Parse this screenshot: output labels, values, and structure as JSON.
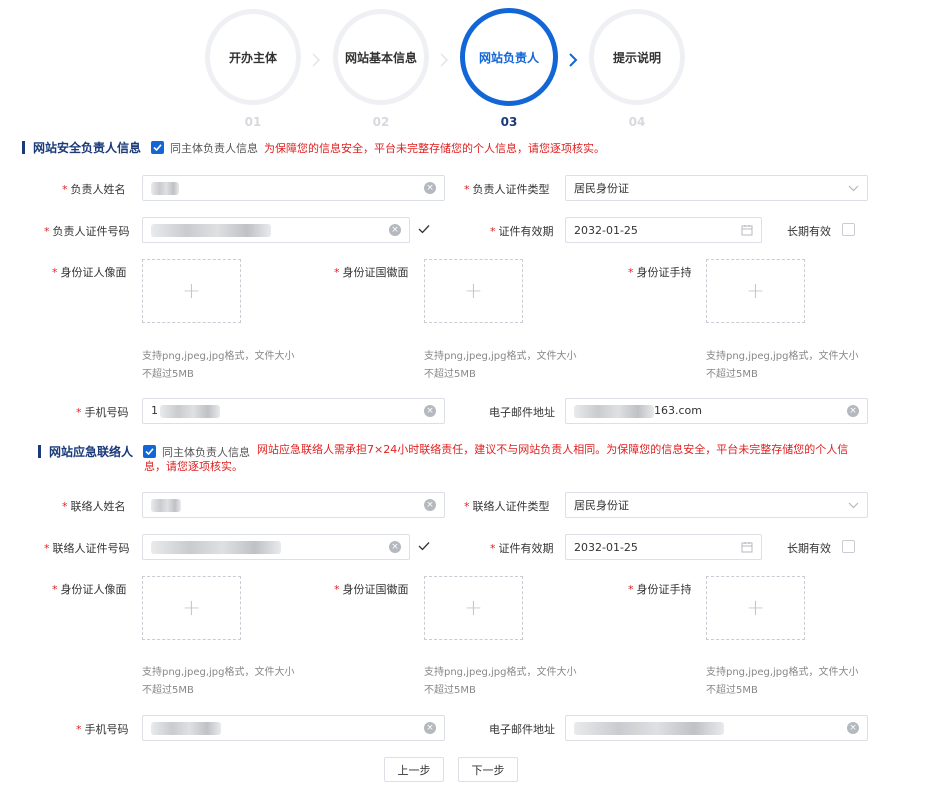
{
  "steps": [
    {
      "label": "开办主体",
      "num": "01"
    },
    {
      "label": "网站基本信息",
      "num": "02"
    },
    {
      "label": "网站负责人",
      "num": "03"
    },
    {
      "label": "提示说明",
      "num": "04"
    }
  ],
  "current_step": 3,
  "section1": {
    "title": "网站安全负责人信息",
    "same_subject": "同主体负责人信息",
    "warning": "为保障您的信息安全，平台未完整存储您的个人信息，请您逐项核实。",
    "name_label": "负责人姓名",
    "id_type_label": "负责人证件类型",
    "id_type_value": "居民身份证",
    "id_number_label": "负责人证件号码",
    "validity_label": "证件有效期",
    "validity_value": "2032-01-25",
    "long_term_label": "长期有效",
    "photo_label": "身份证人像面",
    "emblem_label": "身份证国徽面",
    "handheld_label": "身份证手持",
    "upload_hint": "支持png,jpeg,jpg格式，文件大小不超过5MB",
    "phone_label": "手机号码",
    "phone_prefix": "1",
    "email_label": "电子邮件地址",
    "email_suffix": "163.com"
  },
  "section2": {
    "title": "网站应急联络人",
    "same_subject": "同主体负责人信息",
    "warning": "网站应急联络人需承担7×24小时联络责任，建议不与网站负责人相同。为保障您的信息安全，平台未完整存储您的个人信息，请您逐项核实。",
    "name_label": "联络人姓名",
    "id_type_label": "联络人证件类型",
    "id_type_value": "居民身份证",
    "id_number_label": "联络人证件号码",
    "validity_label": "证件有效期",
    "validity_value": "2032-01-25",
    "long_term_label": "长期有效",
    "photo_label": "身份证人像面",
    "emblem_label": "身份证国徽面",
    "handheld_label": "身份证手持",
    "upload_hint": "支持png,jpeg,jpg格式，文件大小不超过5MB",
    "phone_label": "手机号码",
    "email_label": "电子邮件地址"
  },
  "buttons": {
    "prev": "上一步",
    "next": "下一步"
  },
  "colors": {
    "primary": "#1366d6",
    "section": "#1a3a7a",
    "warning": "#e02020"
  },
  "icons": {
    "clear": "circle-x-icon",
    "calendar": "calendar-icon",
    "dropdown": "chevron-down-icon",
    "check": "check-icon",
    "upload": "plus-icon"
  }
}
